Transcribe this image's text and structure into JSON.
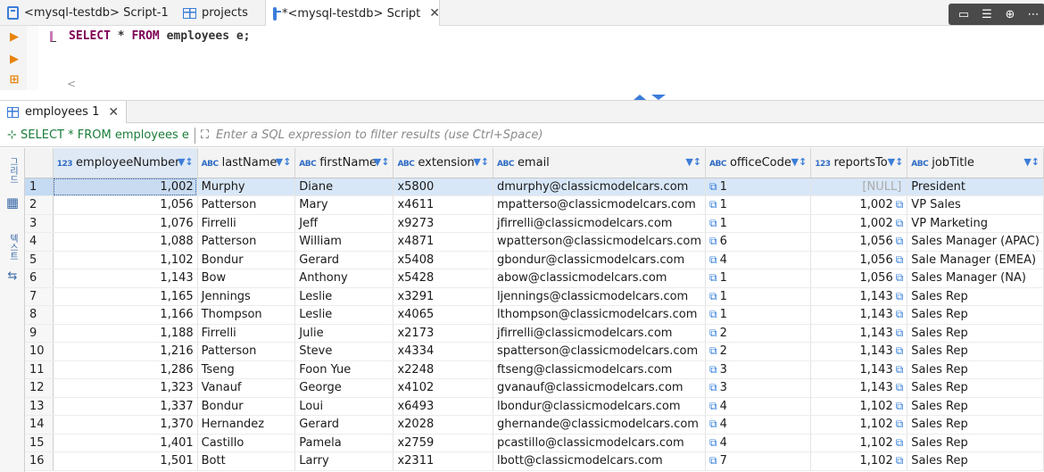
{
  "editor_tabs": [
    {
      "label": "<mysql-testdb> Script-1"
    },
    {
      "label": "projects"
    },
    {
      "label": "*<mysql-testdb> Script"
    }
  ],
  "editor": {
    "code_keyword1": "SELECT",
    "code_mid": " * ",
    "code_keyword2": "FROM",
    "code_rest": " employees e;"
  },
  "result_tab": {
    "label": "employees 1"
  },
  "filter": {
    "query": "SELECT * FROM employees e",
    "placeholder": "Enter a SQL expression to filter results (use Ctrl+Space)"
  },
  "left_toolbar": {
    "grid": "그리드",
    "text": "텍스트"
  },
  "columns": [
    {
      "name": "employeeNumber",
      "type": "123"
    },
    {
      "name": "lastName",
      "type": "ABC"
    },
    {
      "name": "firstName",
      "type": "ABC"
    },
    {
      "name": "extension",
      "type": "ABC"
    },
    {
      "name": "email",
      "type": "ABC"
    },
    {
      "name": "officeCode",
      "type": "ABC"
    },
    {
      "name": "reportsTo",
      "type": "123"
    },
    {
      "name": "jobTitle",
      "type": "ABC"
    }
  ],
  "rows": [
    [
      "1",
      "1,002",
      "Murphy",
      "Diane",
      "x5800",
      "dmurphy@classicmodelcars.com",
      "1",
      "[NULL]",
      "President"
    ],
    [
      "2",
      "1,056",
      "Patterson",
      "Mary",
      "x4611",
      "mpatterso@classicmodelcars.com",
      "1",
      "1,002",
      "VP Sales"
    ],
    [
      "3",
      "1,076",
      "Firrelli",
      "Jeff",
      "x9273",
      "jfirrelli@classicmodelcars.com",
      "1",
      "1,002",
      "VP Marketing"
    ],
    [
      "4",
      "1,088",
      "Patterson",
      "William",
      "x4871",
      "wpatterson@classicmodelcars.com",
      "6",
      "1,056",
      "Sales Manager (APAC)"
    ],
    [
      "5",
      "1,102",
      "Bondur",
      "Gerard",
      "x5408",
      "gbondur@classicmodelcars.com",
      "4",
      "1,056",
      "Sale Manager (EMEA)"
    ],
    [
      "6",
      "1,143",
      "Bow",
      "Anthony",
      "x5428",
      "abow@classicmodelcars.com",
      "1",
      "1,056",
      "Sales Manager (NA)"
    ],
    [
      "7",
      "1,165",
      "Jennings",
      "Leslie",
      "x3291",
      "ljennings@classicmodelcars.com",
      "1",
      "1,143",
      "Sales Rep"
    ],
    [
      "8",
      "1,166",
      "Thompson",
      "Leslie",
      "x4065",
      "lthompson@classicmodelcars.com",
      "1",
      "1,143",
      "Sales Rep"
    ],
    [
      "9",
      "1,188",
      "Firrelli",
      "Julie",
      "x2173",
      "jfirrelli@classicmodelcars.com",
      "2",
      "1,143",
      "Sales Rep"
    ],
    [
      "10",
      "1,216",
      "Patterson",
      "Steve",
      "x4334",
      "spatterson@classicmodelcars.com",
      "2",
      "1,143",
      "Sales Rep"
    ],
    [
      "11",
      "1,286",
      "Tseng",
      "Foon Yue",
      "x2248",
      "ftseng@classicmodelcars.com",
      "3",
      "1,143",
      "Sales Rep"
    ],
    [
      "12",
      "1,323",
      "Vanauf",
      "George",
      "x4102",
      "gvanauf@classicmodelcars.com",
      "3",
      "1,143",
      "Sales Rep"
    ],
    [
      "13",
      "1,337",
      "Bondur",
      "Loui",
      "x6493",
      "lbondur@classicmodelcars.com",
      "4",
      "1,102",
      "Sales Rep"
    ],
    [
      "14",
      "1,370",
      "Hernandez",
      "Gerard",
      "x2028",
      "ghernande@classicmodelcars.com",
      "4",
      "1,102",
      "Sales Rep"
    ],
    [
      "15",
      "1,401",
      "Castillo",
      "Pamela",
      "x2759",
      "pcastillo@classicmodelcars.com",
      "4",
      "1,102",
      "Sales Rep"
    ],
    [
      "16",
      "1,501",
      "Bott",
      "Larry",
      "x2311",
      "lbott@classicmodelcars.com",
      "7",
      "1,102",
      "Sales Rep"
    ]
  ]
}
